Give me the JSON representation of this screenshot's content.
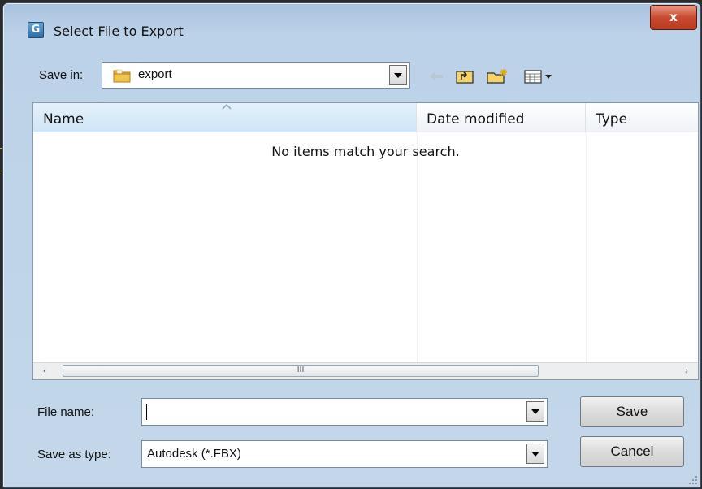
{
  "window": {
    "title": "Select File to Export",
    "app_icon_letter": "G",
    "close_glyph": "x"
  },
  "toolbar": {
    "save_in_label": "Save in:",
    "save_in_value": "export",
    "icons": [
      "back-arrow-icon",
      "up-folder-icon",
      "new-folder-icon",
      "view-menu-icon"
    ]
  },
  "list": {
    "columns": [
      "Name",
      "Date modified",
      "Type"
    ],
    "empty_message": "No items match your search.",
    "scroll_thumb_glyph": "III",
    "scroll_left_glyph": "‹",
    "scroll_right_glyph": "›"
  },
  "form": {
    "file_name_label": "File name:",
    "file_name_value": "",
    "save_as_type_label": "Save as type:",
    "save_as_type_value": "Autodesk (*.FBX)",
    "save_button": "Save",
    "cancel_button": "Cancel"
  },
  "colors": {
    "title_bar": "#b4cce4",
    "close_button": "#c94a30",
    "dialog_bg": "#c4d7ea"
  }
}
